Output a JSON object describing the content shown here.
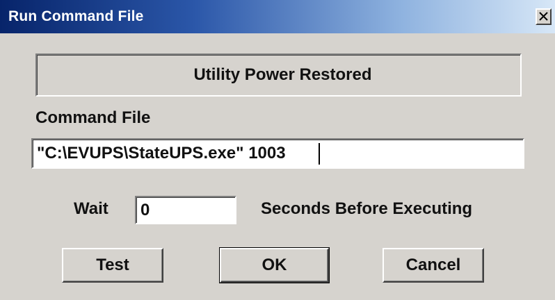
{
  "window": {
    "title": "Run Command File",
    "close_icon": "close-icon"
  },
  "status": {
    "text": "Utility Power Restored"
  },
  "command": {
    "label": "Command File",
    "value": "\"C:\\EVUPS\\StateUPS.exe\" 1003"
  },
  "wait": {
    "label": "Wait",
    "value": "0",
    "suffix": "Seconds Before Executing"
  },
  "buttons": {
    "test": "Test",
    "ok": "OK",
    "cancel": "Cancel"
  },
  "colors": {
    "title_start": "#07246a",
    "title_end": "#d7e7f7",
    "window_bg": "#d6d3ce"
  }
}
